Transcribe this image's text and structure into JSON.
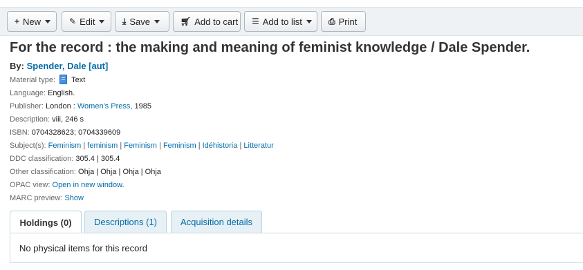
{
  "toolbar": {
    "buttons": [
      {
        "label": "New",
        "icon": "plus-icon",
        "dropdown": true
      },
      {
        "label": "Edit",
        "icon": "pencil-icon",
        "dropdown": true
      },
      {
        "label": "Save",
        "icon": "download-icon",
        "dropdown": true
      },
      {
        "label": "Add to cart",
        "icon": "cart-icon",
        "dropdown": false
      },
      {
        "label": "Add to list",
        "icon": "list-icon",
        "dropdown": true
      },
      {
        "label": "Print",
        "icon": "print-icon",
        "dropdown": false
      }
    ]
  },
  "record": {
    "title": "For the record : the making and meaning of feminist knowledge / Dale Spender.",
    "by_label": "By:",
    "author": "Spender, Dale [aut]",
    "material_type_label": "Material type:",
    "material_type": "Text",
    "language_label": "Language:",
    "language": "English.",
    "publisher_label": "Publisher:",
    "publisher_place": "London :",
    "publisher_name": "Women's Press,",
    "publisher_year": "1985",
    "description_label": "Description:",
    "description": "viii, 246 s",
    "isbn_label": "ISBN:",
    "isbn": "0704328623; 0704339609",
    "subjects_label": "Subject(s):",
    "subjects": [
      "Feminism",
      "feminism",
      "Feminism",
      "Feminism",
      "Idéhistoria",
      "Litteratur"
    ],
    "subject_separator": "|",
    "ddc_label": "DDC classification:",
    "ddc": "305.4 | 305.4",
    "other_class_label": "Other classification:",
    "other_class": "Ohja | Ohja | Ohja | Ohja",
    "opac_label": "OPAC view:",
    "opac_link": "Open in new window",
    "marc_label": "MARC preview:",
    "marc_link": "Show"
  },
  "tabs": [
    {
      "label": "Holdings (0)",
      "active": true
    },
    {
      "label": "Descriptions (1)",
      "active": false
    },
    {
      "label": "Acquisition details",
      "active": false
    }
  ],
  "holdings_message": "No physical items for this record",
  "colors": {
    "link": "#006ca8",
    "toolbar_bg": "#eef2f5",
    "tab_bg": "#e6f0f5"
  }
}
